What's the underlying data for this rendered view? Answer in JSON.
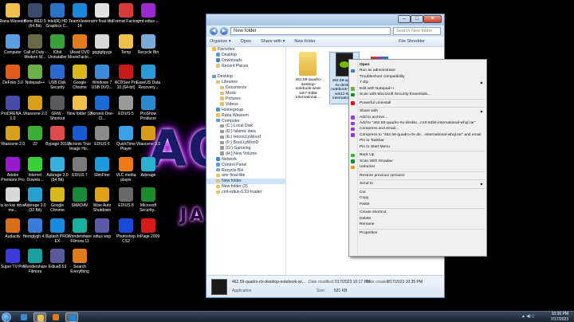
{
  "desktop": {
    "icons": [
      {
        "label": "Rana Waseem",
        "color": "#f0c04a"
      },
      {
        "label": "Bonc RED 5 (64 Bit)",
        "color": "#3a4a6a"
      },
      {
        "label": "Intel(R) HD Graphics C...",
        "color": "#2a72c8"
      },
      {
        "label": "TeamViewer 14",
        "color": "#1a8ad8"
      },
      {
        "label": "amr final title",
        "color": "#e0e0e0"
      },
      {
        "label": "Format Factory",
        "color": "#d83a3a"
      },
      {
        "label": "cmt-edius-...",
        "color": "#9a2ad0"
      },
      {
        "label": "Computer",
        "color": "#5aa0e0"
      },
      {
        "label": "Call of Duty - Modern W...",
        "color": "#6a6a4a"
      },
      {
        "label": "IObit Uninstaller",
        "color": "#3aa03a"
      },
      {
        "label": "Ulead DVD MovieFacto...",
        "color": "#e07a1a"
      },
      {
        "label": "gqgtgfgygs",
        "color": "#d8d8d8"
      },
      {
        "label": "Temp",
        "color": "#f0c04a"
      },
      {
        "label": "Recycle Bin",
        "color": "#7aa8d8"
      },
      {
        "label": "DeFolio 3.0",
        "color": "#e05a1a"
      },
      {
        "label": "Notepad++",
        "color": "#6ab04a"
      },
      {
        "label": "USB Disk Security",
        "color": "#2a6ad0"
      },
      {
        "label": "Google Chrome",
        "color": "#d8b81a"
      },
      {
        "label": "Windows 7 USB DVD...",
        "color": "#3a8ad8"
      },
      {
        "label": "ACDSee Pro 10 (64-bit)",
        "color": "#c81a1a"
      },
      {
        "label": "EaseUS Data Recovery...",
        "color": "#2a9ad8"
      },
      {
        "label": "ProDRENA... 1.0",
        "color": "#4a4aa8"
      },
      {
        "label": "Vitascene 2.0",
        "color": "#d8a01a"
      },
      {
        "label": "GRW - Shortcut",
        "color": "#5a5a5a"
      },
      {
        "label": "New folder (2)",
        "color": "#f0c04a"
      },
      {
        "label": "Acronis One-Cl...",
        "color": "#1a6ad8"
      },
      {
        "label": "EDIUS 5",
        "color": "#9a9a9a"
      },
      {
        "label": "ProShow Producer",
        "color": "#2a8ad0"
      },
      {
        "label": "Vitascene 2.0",
        "color": "#d8a01a"
      },
      {
        "label": "22",
        "color": "#3ab03a"
      },
      {
        "label": "Bypage 2018",
        "color": "#e04a4a"
      },
      {
        "label": "Acronis True Image Ho...",
        "color": "#1a5ad0"
      },
      {
        "label": "EDIUS 6",
        "color": "#8a8a8a"
      },
      {
        "label": "QuickTime Player",
        "color": "#3aa0e8"
      },
      {
        "label": "Vitascene 3.0",
        "color": "#d89a1a"
      },
      {
        "label": "Adobe Premiere Pro",
        "color": "#9a1ad0"
      },
      {
        "label": "Internet Downlo...",
        "color": "#3ad03a"
      },
      {
        "label": "Adorage 3.0 (64 Bit)",
        "color": "#3ab0e0"
      },
      {
        "label": "EDIUS 7",
        "color": "#7a7a7a"
      },
      {
        "label": "SlimFirer",
        "color": "#1a9ad8"
      },
      {
        "label": "VLC media player",
        "color": "#f07a1a"
      },
      {
        "label": "Adorage",
        "color": "#2ab0d0"
      },
      {
        "label": "is ko kisi drive me...",
        "color": "#d8d8d8"
      },
      {
        "label": "Adorage 3.0 (32 Bit)",
        "color": "#2aa0d0"
      },
      {
        "label": "Google Chrome",
        "color": "#d8b81a"
      },
      {
        "label": "SMADAV",
        "color": "#1a8a3a"
      },
      {
        "label": "Wise Auto Shutdown",
        "color": "#e0a01a"
      },
      {
        "label": "EDIUS 8",
        "color": "#6a6a6a"
      },
      {
        "label": "Microsoft Security...",
        "color": "#1a8a2a"
      },
      {
        "label": "Audacity",
        "color": "#d8701a"
      },
      {
        "label": "Hemglygh 4.0",
        "color": "#3a7ad8"
      },
      {
        "label": "Splash PRO EX",
        "color": "#1a8ae0"
      },
      {
        "label": "Wondershare Filmora 11",
        "color": "#1ab0a0"
      },
      {
        "label": "edius wsp",
        "color": "#5a5aa8"
      },
      {
        "label": "Photoshop CS2",
        "color": "#1a4ad8"
      },
      {
        "label": "InPage 2009",
        "color": "#d81a1a"
      },
      {
        "label": "Super TV Pro",
        "color": "#3a3ad8"
      },
      {
        "label": "Wondershare Filmora",
        "color": "#1aa0a0"
      },
      {
        "label": "Edius8.53",
        "color": "#5a5a9a"
      },
      {
        "label": "Search Everything",
        "color": "#e07a1a"
      }
    ],
    "logo_text": "AO",
    "logo_sub": "JA"
  },
  "explorer": {
    "address": "New folder",
    "search_placeholder": "Search New folder",
    "title_buttons": [
      "–",
      "□",
      "✕"
    ],
    "toolbar": [
      "Organize ▾",
      "Open",
      "Share with ▾",
      "New folder"
    ],
    "toolbar_right": "File Shredder",
    "nav_items": [
      {
        "label": "Favorites",
        "icon": "star-icon",
        "indent": 1,
        "color": "#f0c04a"
      },
      {
        "label": "Desktop",
        "icon": "desktop-icon",
        "indent": 2,
        "color": "#5aa0e0"
      },
      {
        "label": "Downloads",
        "icon": "downloads-icon",
        "indent": 2,
        "color": "#3a8ad8"
      },
      {
        "label": "Recent Places",
        "icon": "recent-icon",
        "indent": 2,
        "color": "#e0c07a"
      },
      {
        "label": "",
        "icon": "",
        "indent": 0,
        "color": ""
      },
      {
        "label": "Desktop",
        "icon": "desktop-icon",
        "indent": 1,
        "color": "#5aa0e0"
      },
      {
        "label": "Libraries",
        "icon": "libraries-icon",
        "indent": 2,
        "color": "#e0c07a"
      },
      {
        "label": "Documents",
        "icon": "documents-icon",
        "indent": 3,
        "color": "#e0c07a"
      },
      {
        "label": "Music",
        "icon": "music-icon",
        "indent": 3,
        "color": "#e0c07a"
      },
      {
        "label": "Pictures",
        "icon": "pictures-icon",
        "indent": 3,
        "color": "#e0c07a"
      },
      {
        "label": "Videos",
        "icon": "videos-icon",
        "indent": 3,
        "color": "#e0c07a"
      },
      {
        "label": "Homegroup",
        "icon": "homegroup-icon",
        "indent": 2,
        "color": "#3aa0d8"
      },
      {
        "label": "Rana Waseem",
        "icon": "user-icon",
        "indent": 2,
        "color": "#f0c04a"
      },
      {
        "label": "Computer",
        "icon": "computer-icon",
        "indent": 2,
        "color": "#5aa0e0"
      },
      {
        "label": "(C:) Local Disk",
        "icon": "disk-icon",
        "indent": 3,
        "color": "#9a9a9a"
      },
      {
        "label": "(D:) Islamic data",
        "icon": "disk-icon",
        "indent": 3,
        "color": "#9a9a9a"
      },
      {
        "label": "(E:) HnooLLyWood",
        "icon": "disk-icon",
        "indent": 3,
        "color": "#9a9a9a"
      },
      {
        "label": "(F:) BooLLyWooD",
        "icon": "disk-icon",
        "indent": 3,
        "color": "#9a9a9a"
      },
      {
        "label": "(G:) Gameing",
        "icon": "disk-icon",
        "indent": 3,
        "color": "#9a9a9a"
      },
      {
        "label": "(H:) New Volume",
        "icon": "disk-icon",
        "indent": 3,
        "color": "#9a9a9a"
      },
      {
        "label": "Network",
        "icon": "network-icon",
        "indent": 2,
        "color": "#3a8ad8"
      },
      {
        "label": "Control Panel",
        "icon": "control-panel-icon",
        "indent": 2,
        "color": "#5aa0e0"
      },
      {
        "label": "Recycle Bin",
        "icon": "recycle-bin-icon",
        "indent": 2,
        "color": "#7aa8d8"
      },
      {
        "label": "amr final title",
        "icon": "folder-icon",
        "indent": 2,
        "color": "#f0c04a"
      },
      {
        "label": "New folder",
        "icon": "folder-icon",
        "indent": 2,
        "color": "#f0c04a",
        "selected": true
      },
      {
        "label": "New folder (2)",
        "icon": "folder-icon",
        "indent": 2,
        "color": "#f0c04a"
      },
      {
        "label": "cmt-edius-6.53-loader",
        "icon": "folder-icon",
        "indent": 2,
        "color": "#f0c04a"
      }
    ],
    "files": [
      {
        "name": "461.09-quadro-desktop-notebook-win8-win7-64bit-international-...",
        "type": "folder"
      },
      {
        "name": "462.59-quadro-rtx-desktop-notebook-win10-win11-64bit-international-...",
        "type": "nvidia",
        "selected": true
      },
      {
        "name": "",
        "type": "winrar"
      }
    ],
    "details": {
      "name": "462.59-quadro-rtx-desktop-notebook-wi...",
      "type": "Application",
      "modified_label": "Date modified:",
      "modified_value": "7/17/2023 10:17 PM",
      "size_label": "Size:",
      "size_value": "531 KB",
      "created_label": "Date created:",
      "created_value": "7/17/2023 10:35 PM"
    }
  },
  "context_menu": {
    "items": [
      {
        "label": "Open",
        "bold": true,
        "icon": "",
        "submenu": false
      },
      {
        "label": "Run as administrator",
        "icon": "shield-icon",
        "iconColor": "#3a7ad8",
        "submenu": false
      },
      {
        "label": "Troubleshoot compatibility",
        "icon": "",
        "submenu": false
      },
      {
        "label": "7-Zip",
        "icon": "",
        "submenu": true
      },
      {
        "label": "Edit with Notepad++",
        "icon": "notepad-icon",
        "iconColor": "#6ab04a",
        "submenu": false
      },
      {
        "label": "Scan with Microsoft Security Essentials...",
        "icon": "mse-icon",
        "iconColor": "#1a8a2a",
        "submenu": false
      },
      {
        "sep": true
      },
      {
        "label": "Powerful Uninstall",
        "icon": "uninstall-icon",
        "iconColor": "#d81a1a",
        "submenu": false
      },
      {
        "sep": true
      },
      {
        "label": "Share with",
        "icon": "",
        "submenu": true
      },
      {
        "label": "Add to archive...",
        "icon": "archive-icon",
        "iconColor": "#9a3ad0",
        "submenu": false
      },
      {
        "label": "Add to \"462.59-quadro-rtx-deskto...n10-64bit-international-whql.rar\"",
        "icon": "archive-icon",
        "iconColor": "#9a3ad0",
        "submenu": false
      },
      {
        "label": "Compress and email...",
        "icon": "archive-icon",
        "iconColor": "#9a3ad0",
        "submenu": false
      },
      {
        "label": "Compress to \"462.59-quadro-rtx-de...-international-whql.rar\" and email",
        "icon": "archive-icon",
        "iconColor": "#9a3ad0",
        "submenu": false
      },
      {
        "label": "Pin to Taskbar",
        "icon": "",
        "submenu": false
      },
      {
        "label": "Pin to Start Menu",
        "icon": "",
        "submenu": false
      },
      {
        "sep": true
      },
      {
        "label": "Back Up",
        "icon": "backup-icon",
        "iconColor": "#3ab03a",
        "submenu": false
      },
      {
        "label": "Scan With Smadav",
        "icon": "smadav-icon",
        "iconColor": "#1a8a3a",
        "submenu": false
      },
      {
        "label": "Unlocker",
        "icon": "unlocker-icon",
        "iconColor": "#d8a01a",
        "submenu": false
      },
      {
        "sep": true
      },
      {
        "label": "Restore previous versions",
        "icon": "",
        "submenu": false
      },
      {
        "sep": true
      },
      {
        "label": "Send to",
        "icon": "",
        "submenu": true
      },
      {
        "sep": true
      },
      {
        "label": "Cut",
        "icon": "",
        "submenu": false
      },
      {
        "label": "Copy",
        "icon": "",
        "submenu": false
      },
      {
        "label": "Paste",
        "icon": "",
        "submenu": false
      },
      {
        "sep": true
      },
      {
        "label": "Create shortcut",
        "icon": "",
        "submenu": false
      },
      {
        "label": "Delete",
        "icon": "",
        "submenu": false
      },
      {
        "label": "Rename",
        "icon": "",
        "submenu": false
      },
      {
        "sep": true
      },
      {
        "label": "Properties",
        "icon": "",
        "submenu": false
      }
    ]
  },
  "taskbar": {
    "apps": [
      {
        "name": "ie-icon",
        "color": "#3a8ad8"
      },
      {
        "name": "explorer-icon",
        "color": "#f0c04a",
        "active": true
      },
      {
        "name": "media-player-icon",
        "color": "#e07a1a"
      },
      {
        "name": "teamviewer-icon",
        "color": "#1a8ad8",
        "active": true
      }
    ],
    "time": "10:36 PM",
    "date": "7/17/2023",
    "tray_text": "▲ ◀) ▯"
  }
}
